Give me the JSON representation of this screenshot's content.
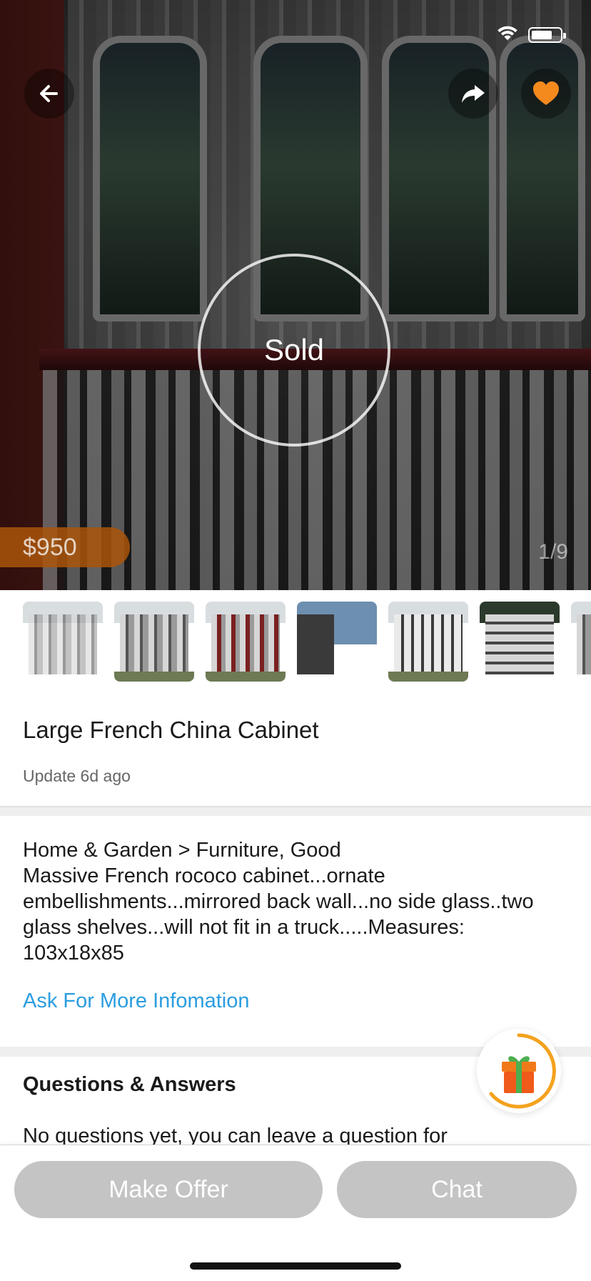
{
  "status_bar": {
    "icons": [
      "wifi-icon",
      "battery-icon"
    ]
  },
  "header": {
    "back_icon": "arrow-left-icon",
    "share_icon": "share-arrow-icon",
    "favorite_icon": "heart-icon",
    "favorite_color": "#F4891E"
  },
  "hero": {
    "sold_label": "Sold",
    "price": "$950",
    "photo_counter": "1/9"
  },
  "thumbnails": {
    "count_visible": 7
  },
  "listing": {
    "title": "Large French China Cabinet",
    "updated": "Update 6d ago",
    "category_line": "Home & Garden > Furniture, Good",
    "description_lines": [
      "Massive French rococo cabinet...ornate",
      "embellishments...mirrored back wall...no side glass..two",
      "glass shelves...will not fit in a truck.....Measures:",
      "103x18x85"
    ],
    "ask_link": "Ask For More Infomation",
    "link_color": "#2A9DE0"
  },
  "qa": {
    "title": "Questions & Answers",
    "empty_text": "No questions yet, you can leave a question for"
  },
  "floating": {
    "gift_icon": "gift-icon",
    "ring_color": "#F4A21E"
  },
  "bottom_bar": {
    "make_offer_label": "Make Offer",
    "chat_label": "Chat",
    "button_color": "#C4C4C4"
  }
}
